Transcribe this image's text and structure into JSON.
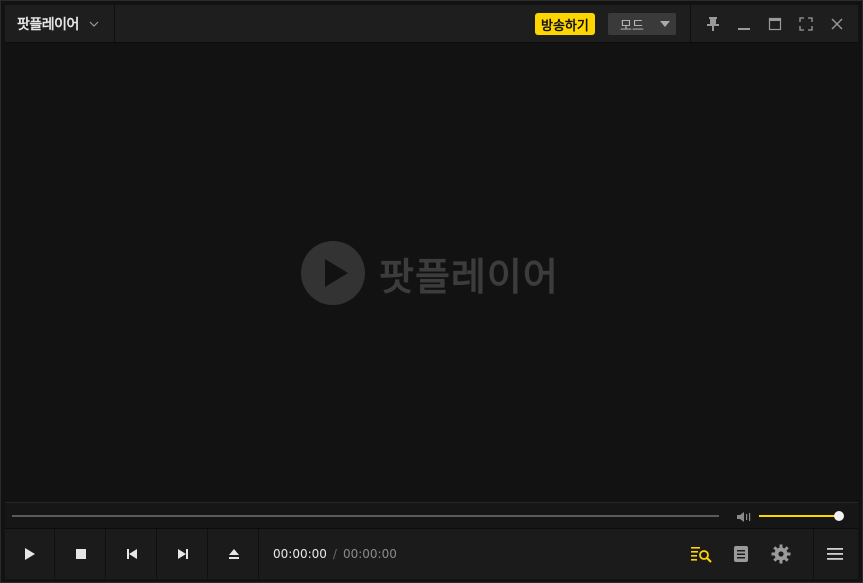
{
  "titlebar": {
    "app_title": "팟플레이어",
    "broadcast_label": "방송하기",
    "mode_label": "모드"
  },
  "video": {
    "logo_text": "팟플레이어"
  },
  "seek": {
    "progress": 0
  },
  "volume": {
    "level": 1.0
  },
  "playback": {
    "current_time": "00:00:00",
    "separator": "/",
    "total_time": "00:00:00"
  },
  "colors": {
    "accent": "#ffd500",
    "background": "#121212",
    "bar": "#1b1b1b"
  },
  "icons": {
    "titlebar": [
      "pin-icon",
      "minimize-icon",
      "maximize-icon",
      "fullscreen-icon",
      "close-icon"
    ],
    "controls": [
      "play-icon",
      "stop-icon",
      "previous-icon",
      "next-icon",
      "eject-icon"
    ],
    "right": [
      "playlist-search-icon",
      "chapter-icon",
      "settings-icon",
      "menu-icon"
    ]
  }
}
